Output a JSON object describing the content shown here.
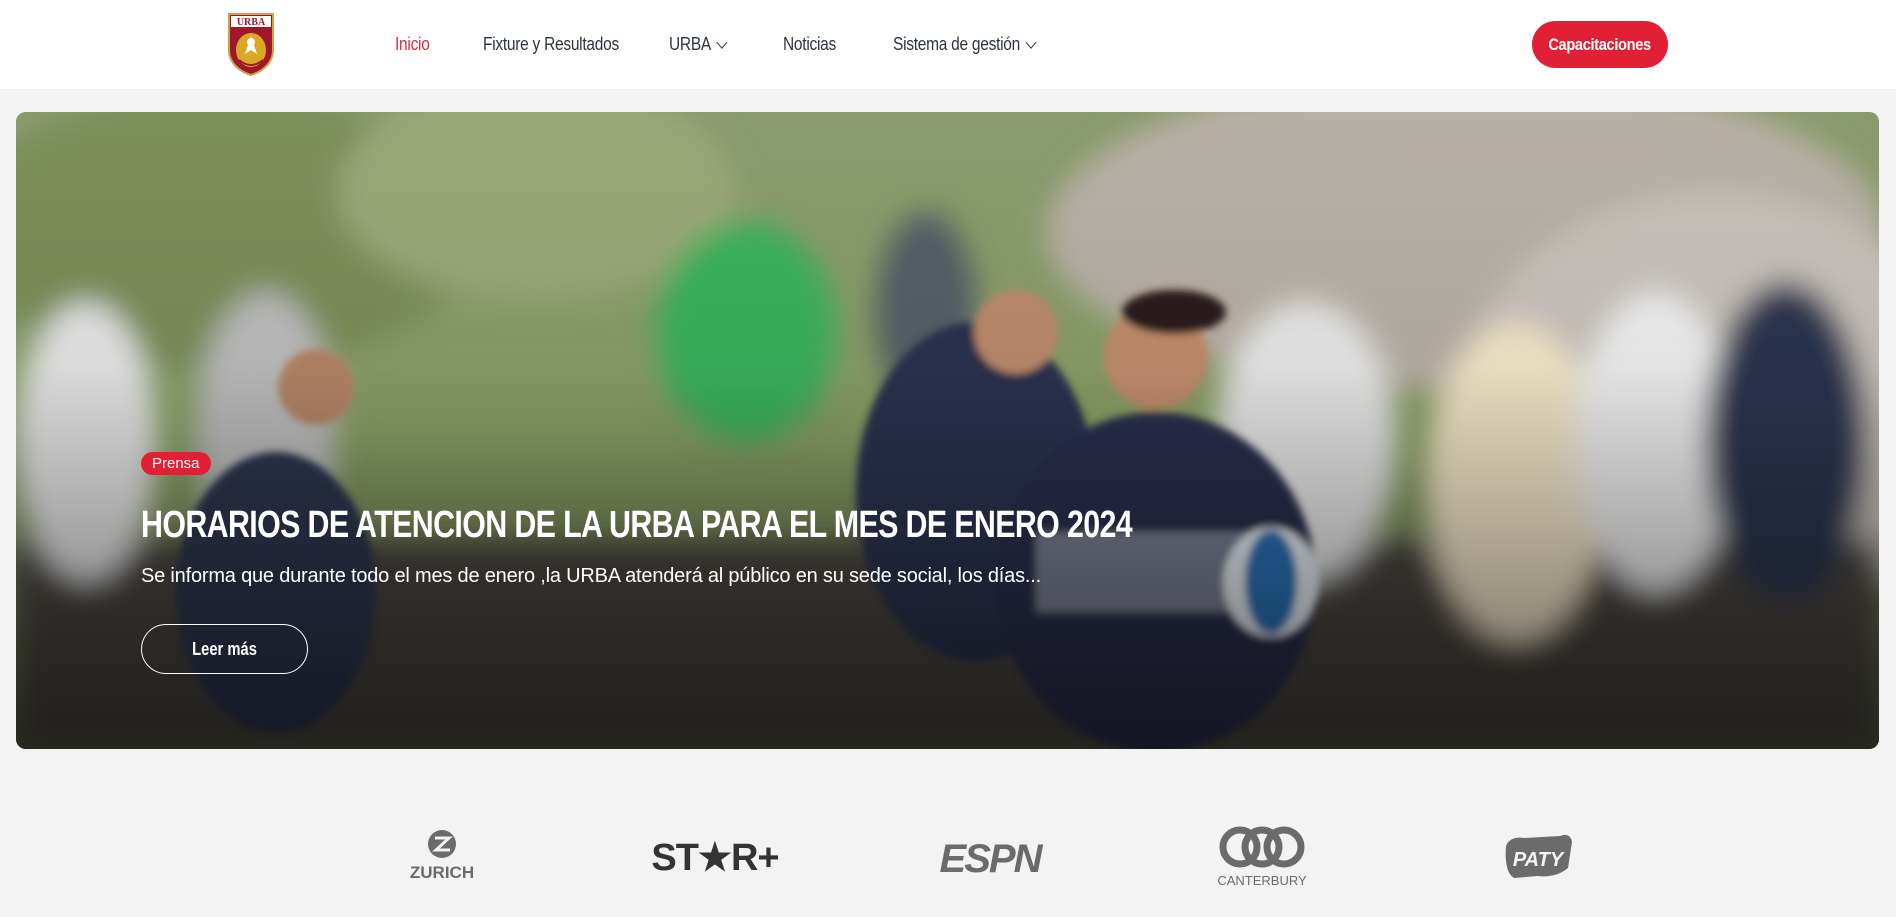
{
  "header": {
    "logo_text": "URBA",
    "nav": [
      {
        "label": "Inicio",
        "active": true,
        "dropdown": false
      },
      {
        "label": "Fixture y Resultados",
        "active": false,
        "dropdown": false
      },
      {
        "label": "URBA",
        "active": false,
        "dropdown": true
      },
      {
        "label": "Noticias",
        "active": false,
        "dropdown": false
      },
      {
        "label": "Sistema de gestión",
        "active": false,
        "dropdown": true
      }
    ],
    "cta_label": "Capacitaciones"
  },
  "hero": {
    "category": "Prensa",
    "title": "HORARIOS DE ATENCION DE LA URBA PARA EL MES DE ENERO 2024",
    "excerpt": "Se informa que durante todo el mes de enero ,la URBA atenderá al público en su sede social, los días...",
    "button_label": "Leer más"
  },
  "sponsors": [
    {
      "name": "ZURICH",
      "icon": "zurich-logo"
    },
    {
      "name": "ST★R+",
      "icon": "star-plus-logo"
    },
    {
      "name": "ESPN",
      "icon": "espn-logo"
    },
    {
      "name": "CANTERBURY",
      "icon": "canterbury-logo"
    },
    {
      "name": "PATY",
      "icon": "paty-logo"
    }
  ],
  "colors": {
    "accent": "#e11f35",
    "nav_text": "#2d3440",
    "page_bg": "#f3f3f3",
    "sponsor_gray": "#6b6b6b"
  }
}
